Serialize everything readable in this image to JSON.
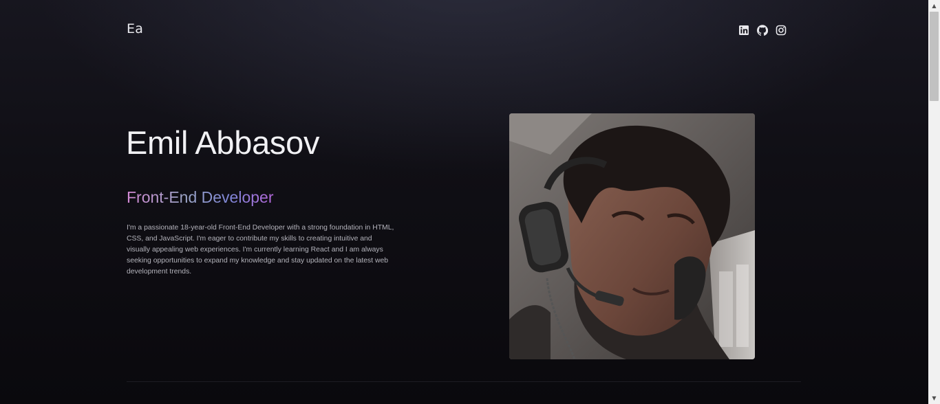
{
  "header": {
    "logo": "Ea",
    "socials": [
      {
        "name": "linkedin",
        "icon": "linkedin-icon"
      },
      {
        "name": "github",
        "icon": "github-icon"
      },
      {
        "name": "instagram",
        "icon": "instagram-icon"
      }
    ]
  },
  "hero": {
    "name": "Emil Abbasov",
    "role": "Front-End Developer",
    "bio": "I'm a passionate 18-year-old Front-End Developer with a strong foundation in HTML, CSS, and JavaScript. I'm eager to contribute my skills to creating intuitive and visually appealing web experiences. I'm currently learning React and I am always seeking opportunities to expand my knowledge and stay updated on the latest web development trends.",
    "photo": "profile-photo"
  },
  "colors": {
    "background": "#0b0a0f",
    "text": "#f1f1f4",
    "gradient_start": "#d58ad6",
    "gradient_end": "#b567db"
  }
}
